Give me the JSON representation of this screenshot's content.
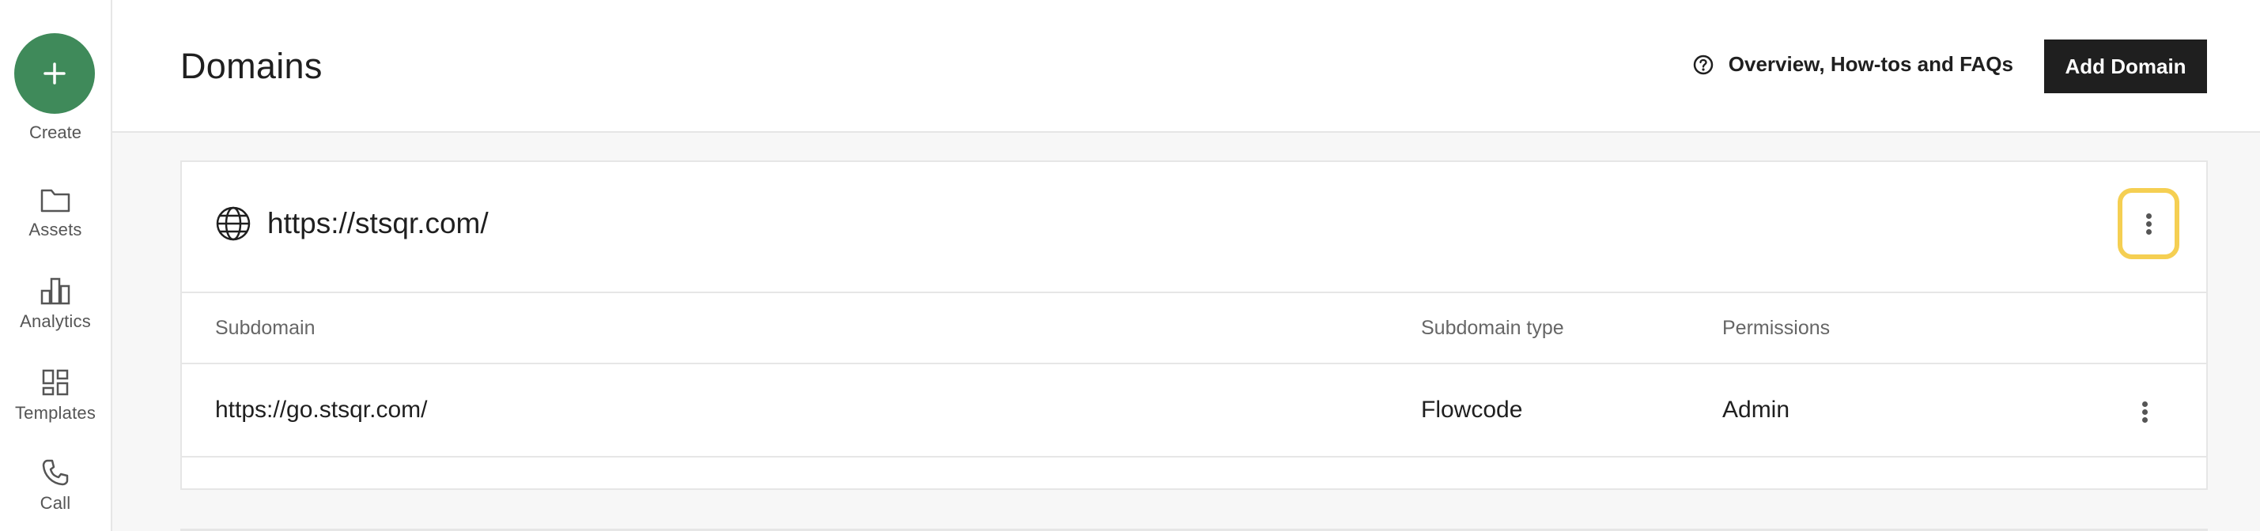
{
  "sidebar": {
    "create_label": "Create",
    "items": [
      {
        "label": "Assets",
        "icon": "folder-icon"
      },
      {
        "label": "Analytics",
        "icon": "bar-chart-icon"
      },
      {
        "label": "Templates",
        "icon": "grid-icon"
      },
      {
        "label": "Call",
        "icon": "phone-icon"
      }
    ]
  },
  "header": {
    "title": "Domains",
    "help_link": "Overview, How-tos and FAQs",
    "add_button": "Add Domain"
  },
  "domain_card": {
    "domain": "https://stsqr.com/",
    "table": {
      "columns": [
        "Subdomain",
        "Subdomain type",
        "Permissions"
      ],
      "rows": [
        {
          "subdomain": "https://go.stsqr.com/",
          "type": "Flowcode",
          "permissions": "Admin"
        }
      ]
    }
  },
  "colors": {
    "create_button": "#3f8a5a",
    "primary_button": "#1f1f1f",
    "highlight": "#f5cf52"
  }
}
